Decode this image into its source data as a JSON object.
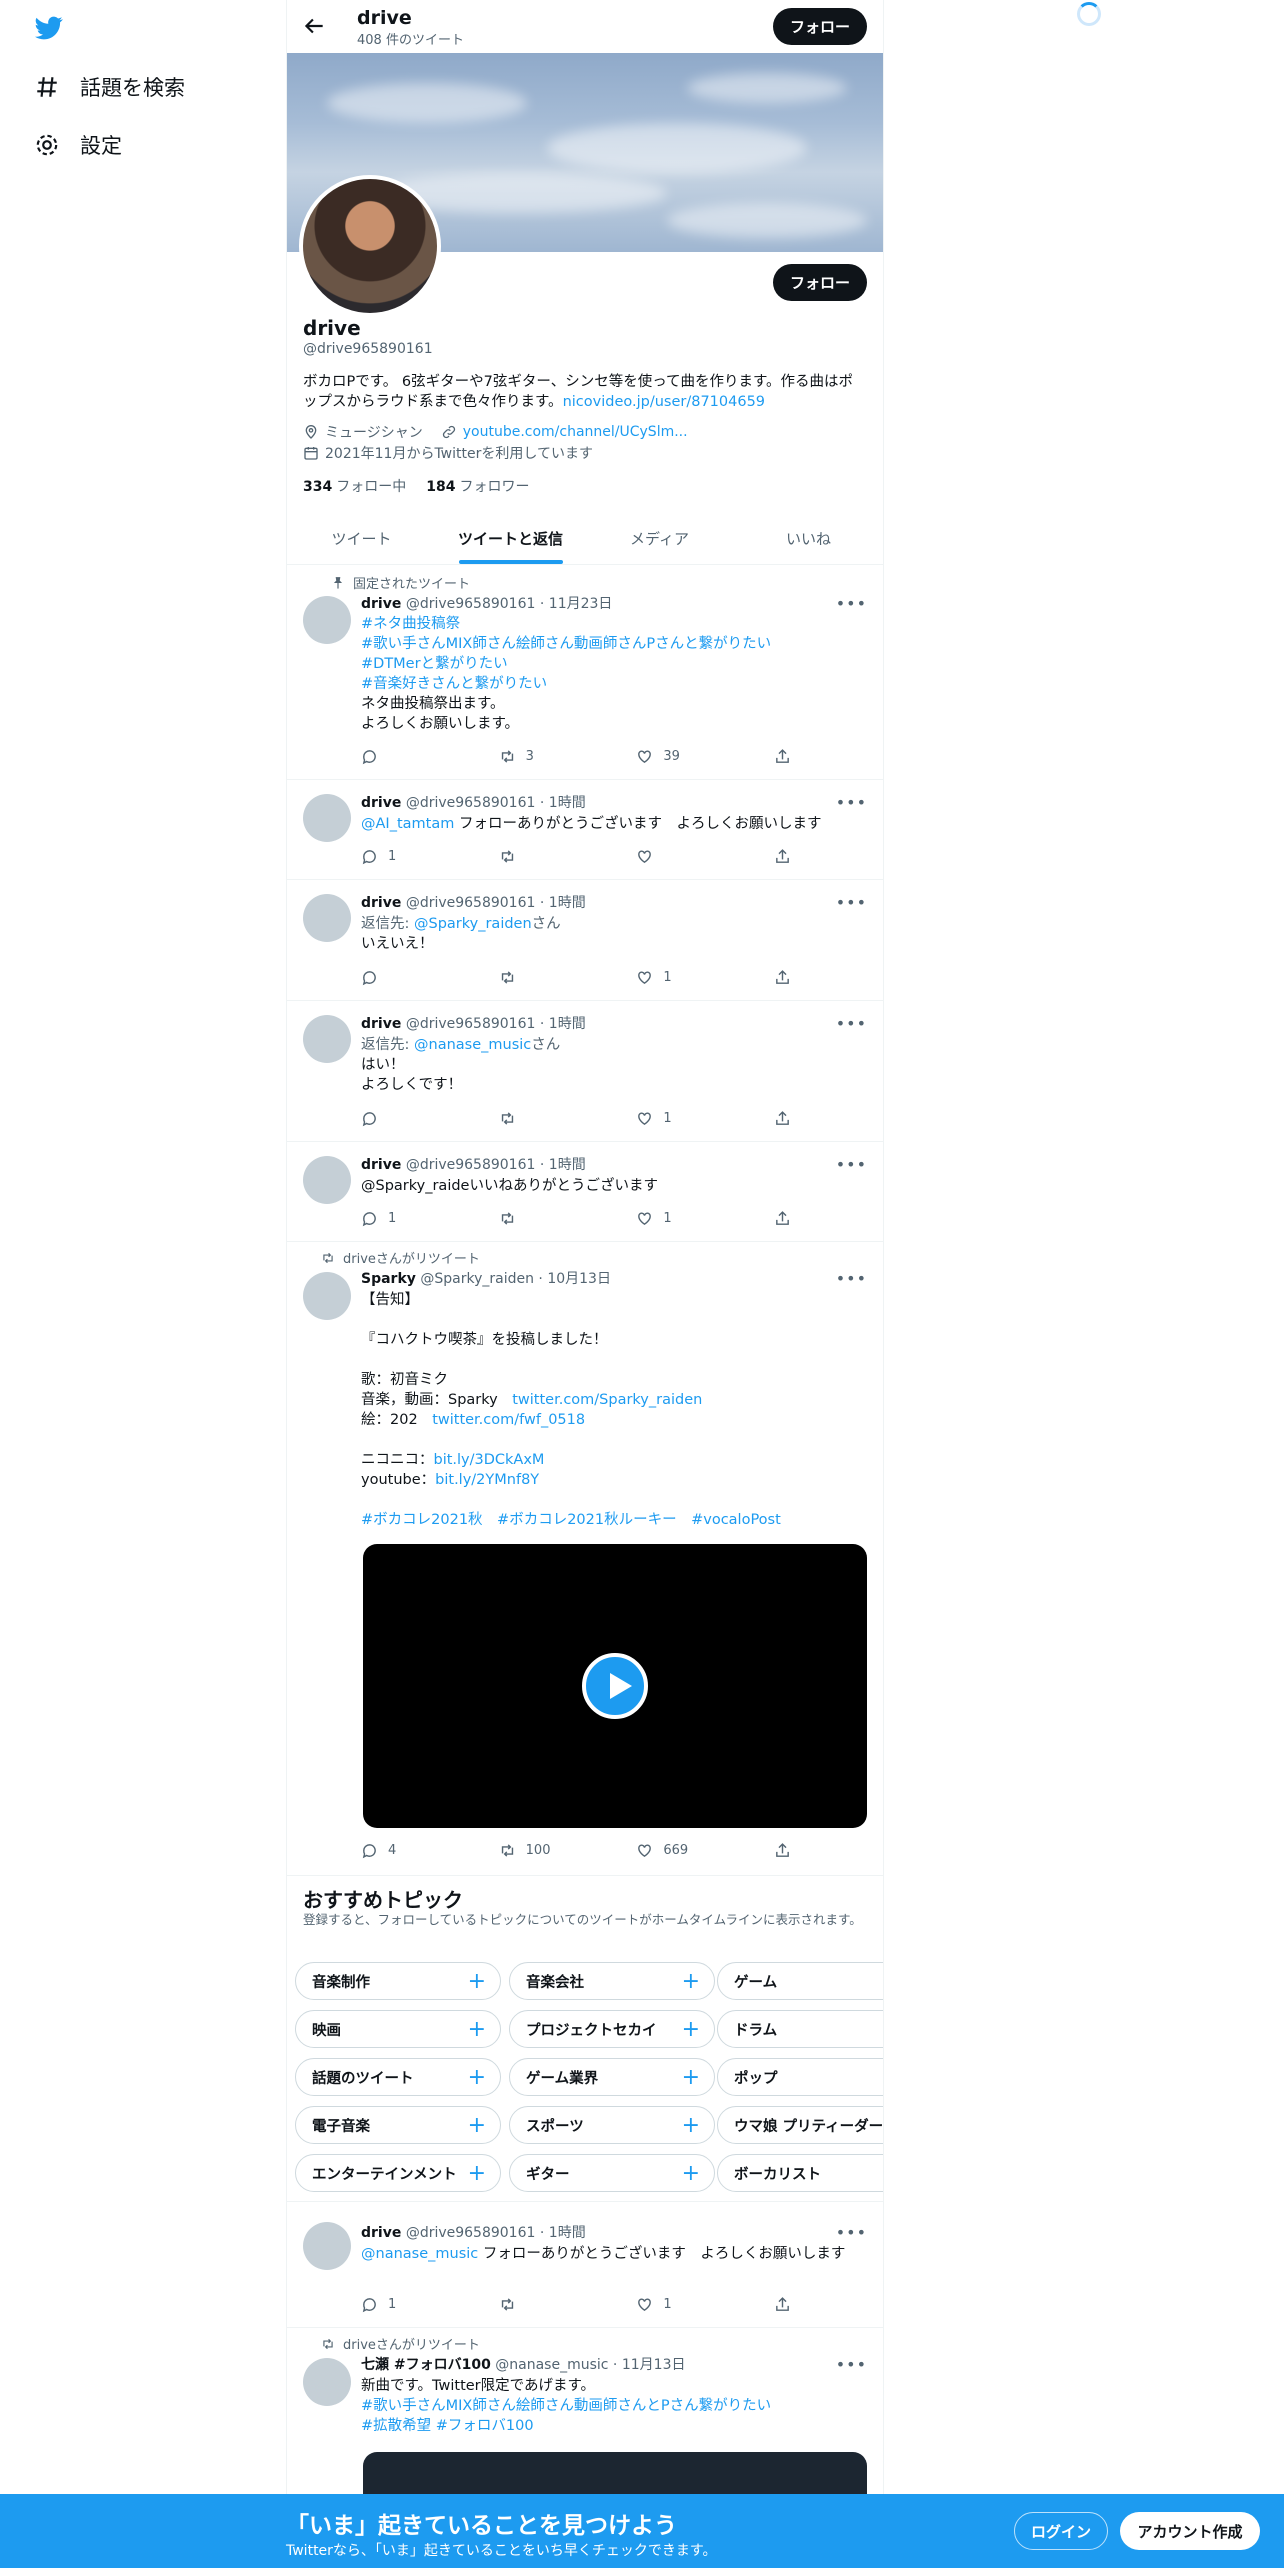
{
  "nav": {
    "explore_label": "話題を検索",
    "settings_label": "設定"
  },
  "header": {
    "name": "drive",
    "tweet_count": "408 件のツイート",
    "follow_label": "フォロー"
  },
  "profile": {
    "name": "drive",
    "handle": "@drive965890161",
    "bio": "ボカロPです。 6弦ギターや7弦ギター、シンセ等を使って曲を作ります。作る曲はポップスからラウド系まで色々作ります。",
    "bio_link": "nicovideo.jp/user/87104659",
    "category": "ミュージシャン",
    "website": "youtube.com/channel/UCySlm...",
    "joined": "2021年11月からTwitterを利用しています",
    "following_count": "334",
    "following_label": "フォロー中",
    "followers_count": "184",
    "followers_label": "フォロワー",
    "follow_label": "フォロー"
  },
  "tabs": [
    "ツイート",
    "ツイートと返信",
    "メディア",
    "いいね"
  ],
  "tweets": [
    {
      "context": "固定されたツイート",
      "name": "drive",
      "handle": "@drive965890161",
      "time": "11月23日",
      "hashtags": [
        "#ネタ曲投稿祭",
        "#歌い手さんMIX師さん絵師さん動画師さんPさんと繋がりたい",
        "#DTMerと繋がりたい",
        "#音楽好きさんと繋がりたい"
      ],
      "text": "ネタ曲投稿祭出ます。\nよろしくお願いします。",
      "reply": "",
      "retweet": "3",
      "like": "39"
    },
    {
      "name": "drive",
      "handle": "@drive965890161",
      "time": "1時間",
      "mention": "@AI_tamtam",
      "text": " フォローありがとうございます　よろしくお願いします",
      "reply": "1",
      "retweet": "",
      "like": ""
    },
    {
      "name": "drive",
      "handle": "@drive965890161",
      "time": "1時間",
      "reply_to_prefix": "返信先: ",
      "reply_to": "@Sparky_raiden",
      "reply_to_suffix": "さん",
      "text": "いえいえ！",
      "reply": "",
      "retweet": "",
      "like": "1"
    },
    {
      "name": "drive",
      "handle": "@drive965890161",
      "time": "1時間",
      "reply_to_prefix": "返信先: ",
      "reply_to": "@nanase_music",
      "reply_to_suffix": "さん",
      "text": "はい！\nよろしくです！",
      "reply": "",
      "retweet": "",
      "like": "1"
    },
    {
      "name": "drive",
      "handle": "@drive965890161",
      "time": "1時間",
      "text": "@Sparky_raideいいねありがとうございます",
      "reply": "1",
      "retweet": "",
      "like": "1"
    },
    {
      "context": "driveさんがリツイート",
      "name": "Sparky",
      "handle": "@Sparky_raiden",
      "time": "10月13日",
      "lines": {
        "l1": "【告知】",
        "l2": "『コハクトウ喫茶』を投稿しました！",
        "l3": "歌：初音ミク",
        "l4_prefix": "音楽，動画：Sparky　",
        "l4_link": "twitter.com/Sparky_raiden",
        "l5_prefix": "絵：202　",
        "l5_link": "twitter.com/fwf_0518",
        "l6_prefix": "ニコニコ：",
        "l6_link": "bit.ly/3DCkAxM",
        "l7_prefix": "youtube：",
        "l7_link": "bit.ly/2YMnf8Y",
        "tags": "#ボカコレ2021秋　#ボカコレ2021秋ルーキー　#vocaloPost"
      },
      "reply": "4",
      "retweet": "100",
      "like": "669"
    },
    {
      "name": "drive",
      "handle": "@drive965890161",
      "time": "1時間",
      "mention": "@nanase_music",
      "text": " フォローありがとうございます　よろしくお願いします",
      "reply": "1",
      "retweet": "",
      "like": "1"
    },
    {
      "context": "driveさんがリツイート",
      "name": "七瀬 #フォロバ100",
      "handle": "@nanase_music",
      "time": "11月13日",
      "text": "新曲です。Twitter限定であげます。",
      "hashtags": [
        "#歌い手さんMIX師さん絵師さん動画師さんとPさん繋がりたい",
        "#拡散希望 #フォロバ100"
      ]
    }
  ],
  "topics": {
    "title": "おすすめトピック",
    "subtitle": "登録すると、フォローしているトピックについてのツイートがホームタイムラインに表示されます。",
    "items": [
      [
        "音楽制作",
        "音楽会社",
        "ゲーム"
      ],
      [
        "映画",
        "プロジェクトセカイ",
        "ドラム"
      ],
      [
        "話題のツイート",
        "ゲーム業界",
        "ポップ"
      ],
      [
        "電子音楽",
        "スポーツ",
        "ウマ娘 プリティーダービー"
      ],
      [
        "エンターテインメント",
        "ギター",
        "ボーカリスト"
      ]
    ]
  },
  "bottom": {
    "title": "「いま」起きていることを見つけよう",
    "subtitle": "Twitterなら、「いま」起きていることをいち早くチェックできます。",
    "login": "ログイン",
    "signup": "アカウント作成"
  },
  "colors": {
    "accent": "#1d9bf0",
    "text": "#0f1419",
    "muted": "#536471"
  }
}
